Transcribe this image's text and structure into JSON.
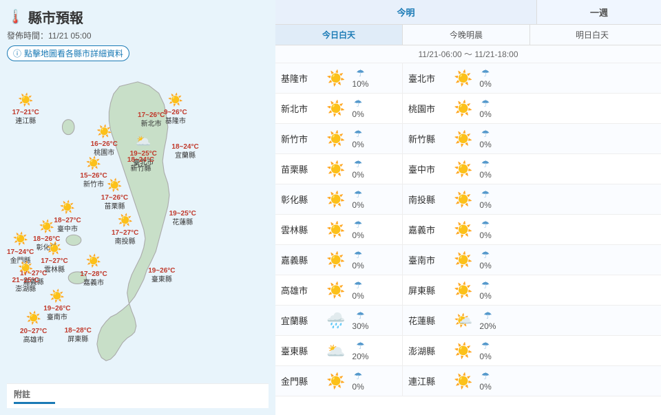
{
  "page": {
    "title": "縣市預報",
    "title_icon": "🌡️",
    "publish_time": "發佈時間：11/21 05:00",
    "map_btn_label": "點擊地圖看各縣市詳細資料"
  },
  "header": {
    "today_label": "今明",
    "week_label": "一週",
    "sub_today": "今日白天",
    "sub_evening": "今晚明晨",
    "sub_tomorrow": "明日白天",
    "date_range": "11/21-06:00 ～ 11/21-18:00"
  },
  "map_cities": [
    {
      "name": "連江縣",
      "temp": "17~21°C",
      "icon": "☀️",
      "class": "lianjiang"
    },
    {
      "name": "金門縣",
      "temp": "17~24°C",
      "icon": "☀️",
      "class": "jinmen"
    },
    {
      "name": "澎湖縣",
      "temp": "21~25°C",
      "icon": "☀️",
      "class": "penghu"
    },
    {
      "name": "新北市",
      "temp": "17~26°C",
      "icon": "☀️",
      "class": "xinbei"
    },
    {
      "name": "基隆市",
      "temp": "9~26°C",
      "icon": "☀️",
      "class": "jilong"
    },
    {
      "name": "臺北市",
      "temp": "19~25°C",
      "icon": "☀️",
      "class": "taipei"
    },
    {
      "name": "桃園市",
      "temp": "16~26°C",
      "icon": "☀️",
      "class": "taoyuan"
    },
    {
      "name": "新竹市",
      "temp": "15~26°C",
      "icon": "☀️",
      "class": "xinzhu-city"
    },
    {
      "name": "新竹縣",
      "temp": "18~24°C",
      "icon": "☀️",
      "class": "xinzhu-county"
    },
    {
      "name": "苗栗縣",
      "temp": "17~26°C",
      "icon": "☀️",
      "class": "miaoli"
    },
    {
      "name": "臺中市",
      "temp": "18~27°C",
      "icon": "☀️",
      "class": "taichung"
    },
    {
      "name": "彰化縣",
      "temp": "18~26°C",
      "icon": "☀️",
      "class": "changhua"
    },
    {
      "name": "南投縣",
      "temp": "17~27°C",
      "icon": "☀️",
      "class": "nantou"
    },
    {
      "name": "雲林縣",
      "temp": "17~27°C",
      "icon": "☀️",
      "class": "yunlin"
    },
    {
      "name": "嘉義市",
      "temp": "17~28°C",
      "icon": "☀️",
      "class": "jiayi-city"
    },
    {
      "name": "嘉義縣",
      "temp": "17~27°C",
      "icon": "☀️",
      "class": "jiayi-county"
    },
    {
      "name": "臺南市",
      "temp": "19~26°C",
      "icon": "☀️",
      "class": "tainan"
    },
    {
      "name": "高雄市",
      "temp": "20~27°C",
      "icon": "☀️",
      "class": "kaohsiung"
    },
    {
      "name": "屏東縣",
      "temp": "18~28°C",
      "icon": "☀️",
      "class": "pingtung"
    },
    {
      "name": "宜蘭縣",
      "temp": "18~24°C",
      "icon": "🌥️",
      "class": "yilan"
    },
    {
      "name": "花蓮縣",
      "temp": "19~25°C",
      "icon": "🌤️",
      "class": "hualien"
    },
    {
      "name": "臺東縣",
      "temp": "19~26°C",
      "icon": "⛅",
      "class": "taidong"
    }
  ],
  "weather_rows": [
    {
      "left": {
        "name": "基隆市",
        "icon": "☀️",
        "rain": "10%"
      },
      "right": {
        "name": "臺北市",
        "icon": "☀️",
        "rain": "0%"
      }
    },
    {
      "left": {
        "name": "新北市",
        "icon": "☀️",
        "rain": "0%"
      },
      "right": {
        "name": "桃園市",
        "icon": "☀️",
        "rain": "0%"
      }
    },
    {
      "left": {
        "name": "新竹市",
        "icon": "☀️",
        "rain": "0%"
      },
      "right": {
        "name": "新竹縣",
        "icon": "☀️",
        "rain": "0%"
      }
    },
    {
      "left": {
        "name": "苗栗縣",
        "icon": "☀️",
        "rain": "0%"
      },
      "right": {
        "name": "臺中市",
        "icon": "☀️",
        "rain": "0%"
      }
    },
    {
      "left": {
        "name": "彰化縣",
        "icon": "☀️",
        "rain": "0%"
      },
      "right": {
        "name": "南投縣",
        "icon": "☀️",
        "rain": "0%"
      }
    },
    {
      "left": {
        "name": "雲林縣",
        "icon": "☀️",
        "rain": "0%"
      },
      "right": {
        "name": "嘉義市",
        "icon": "☀️",
        "rain": "0%"
      }
    },
    {
      "left": {
        "name": "嘉義縣",
        "icon": "☀️",
        "rain": "0%"
      },
      "right": {
        "name": "臺南市",
        "icon": "☀️",
        "rain": "0%"
      }
    },
    {
      "left": {
        "name": "高雄市",
        "icon": "☀️",
        "rain": "0%"
      },
      "right": {
        "name": "屏東縣",
        "icon": "☀️",
        "rain": "0%"
      }
    },
    {
      "left": {
        "name": "宜蘭縣",
        "icon": "🌧️",
        "rain": "30%"
      },
      "right": {
        "name": "花蓮縣",
        "icon": "🌤️",
        "rain": "20%"
      }
    },
    {
      "left": {
        "name": "臺東縣",
        "icon": "🌥️",
        "rain": "20%"
      },
      "right": {
        "name": "澎湖縣",
        "icon": "☀️",
        "rain": "0%"
      }
    },
    {
      "left": {
        "name": "金門縣",
        "icon": "☀️",
        "rain": "0%"
      },
      "right": {
        "name": "連江縣",
        "icon": "☀️",
        "rain": "0%"
      }
    }
  ],
  "footer": {
    "label": "附註"
  },
  "icons": {
    "thermometer": "🌡️",
    "info": "ⓘ",
    "sunny": "☀️",
    "partly_cloudy": "🌤️",
    "cloudy": "⛅",
    "rainy": "🌧️",
    "rain_drop": "☂"
  },
  "colors": {
    "accent_blue": "#1a7ab5",
    "temp_red": "#c0392b",
    "bg_light": "#e8f4fb",
    "header_blue": "#e0ecf8"
  }
}
